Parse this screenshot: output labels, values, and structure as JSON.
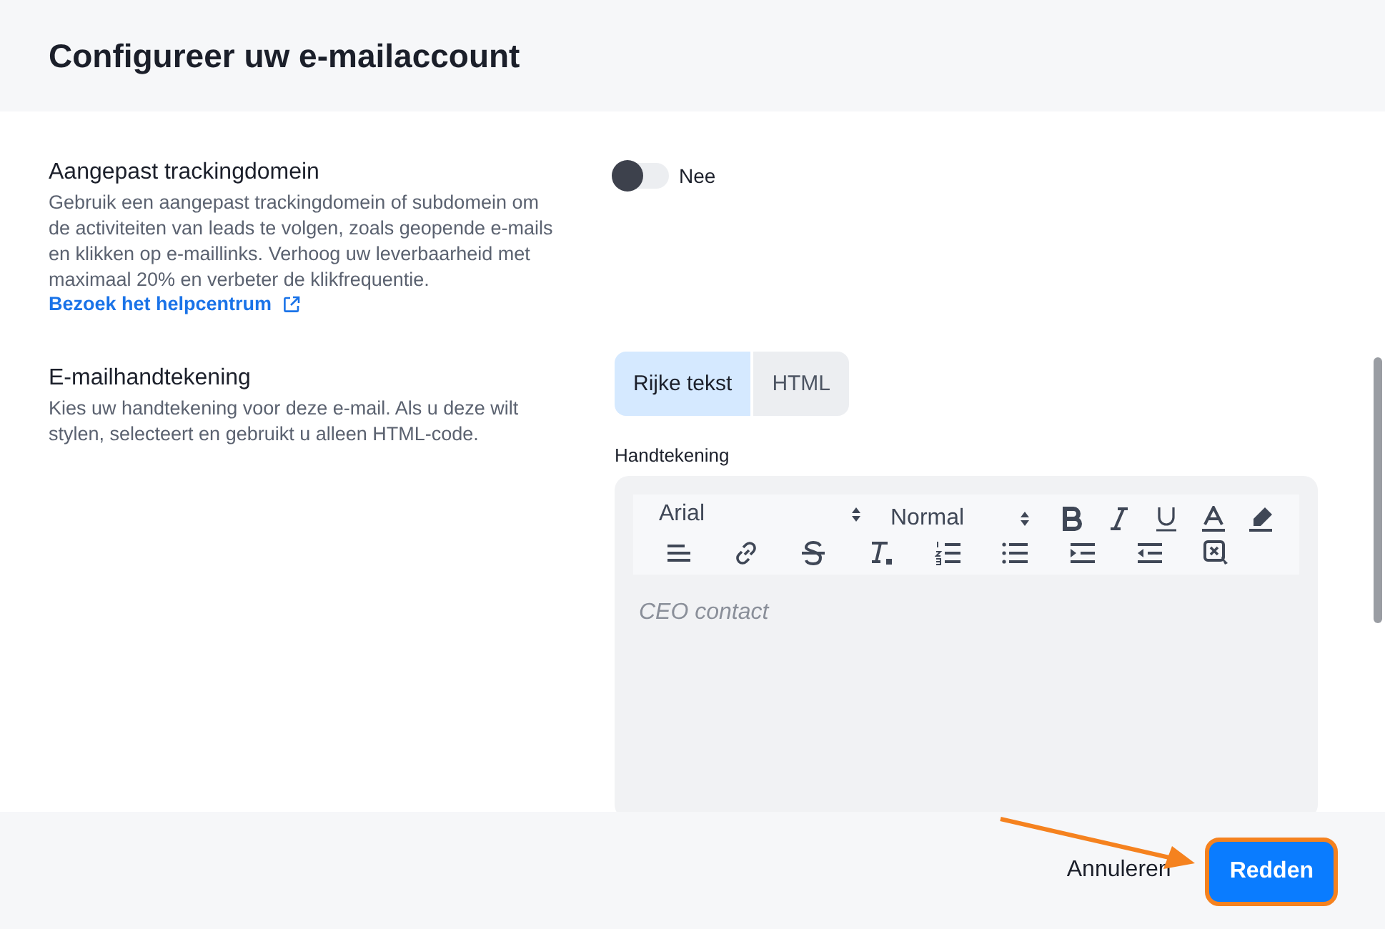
{
  "window": {
    "title": "Configureer uw e-mailaccount"
  },
  "tracking": {
    "title": "Aangepast trackingdomein",
    "description": "Gebruik een aangepast trackingdomein of subdomein om de activiteiten van leads te volgen, zoals geopende e-mails en klikken op e-maillinks. Verhoog uw leverbaarheid met maximaal 20% en verbeter de klikfrequentie.",
    "link": "Bezoek het helpcentrum",
    "toggle": {
      "on": false,
      "label": "Nee"
    }
  },
  "signature": {
    "title": "E-mailhandtekening",
    "description": "Kies uw handtekening voor deze e-mail. Als u deze wilt stylen, selecteert en gebruikt u alleen HTML-code.",
    "tabs": [
      {
        "label": "Rijke tekst",
        "selected": true
      },
      {
        "label": "HTML",
        "selected": false
      }
    ],
    "field_label": "Handtekening",
    "font": "Arial",
    "size": "Normal",
    "placeholder": "CEO contact"
  },
  "footer": {
    "cancel": "Annuleren",
    "save": {
      "label": "Redden",
      "highlighted": true
    }
  }
}
